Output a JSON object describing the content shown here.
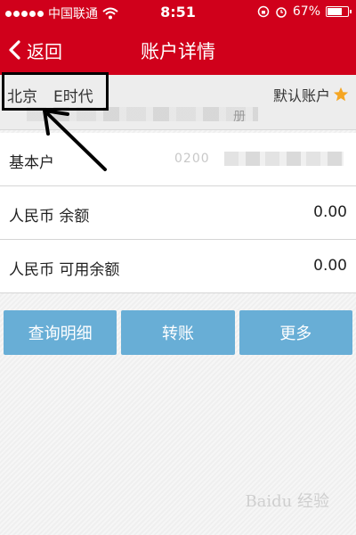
{
  "status_bar": {
    "carrier": "中国联通",
    "time": "8:51",
    "battery_percent": "67%"
  },
  "nav": {
    "back_label": "返回",
    "title": "账户详情"
  },
  "account": {
    "name_part1": "北京",
    "name_part2": "E时代",
    "default_label": "默认账户",
    "number_tail": "册"
  },
  "rows": [
    {
      "label": "基本户",
      "value_prefix": "0200"
    },
    {
      "label": "人民币 余额",
      "value": "0.00"
    },
    {
      "label": "人民币 可用余额",
      "value": "0.00"
    }
  ],
  "buttons": [
    {
      "label": "查询明细"
    },
    {
      "label": "转账"
    },
    {
      "label": "更多"
    }
  ],
  "watermark": "Baidu 经验",
  "colors": {
    "brand_red": "#d0001b",
    "button_blue": "#68aed6",
    "star_orange": "#f5a623"
  }
}
